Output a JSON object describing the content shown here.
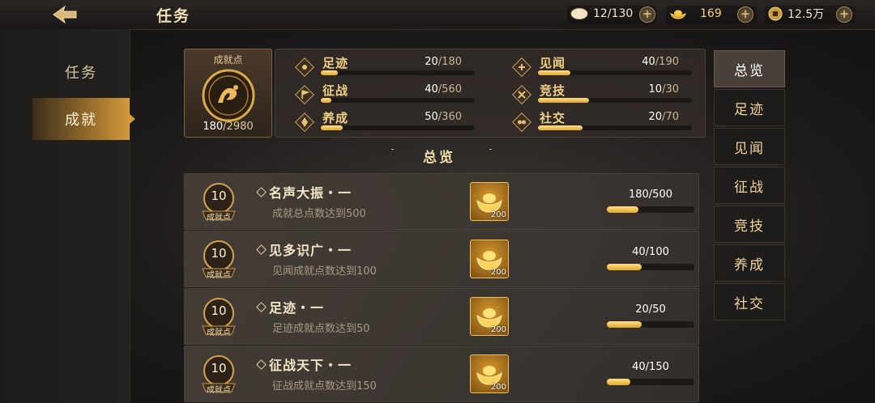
{
  "header": {
    "title": "任务"
  },
  "resources": [
    {
      "icon": "egg-icon",
      "value": "12/130"
    },
    {
      "icon": "gold-ingot-icon",
      "value": "169"
    },
    {
      "icon": "coin-icon",
      "value": "12.5万"
    }
  ],
  "left_tabs": [
    {
      "label": "任务",
      "active": false
    },
    {
      "label": "成就",
      "active": true
    }
  ],
  "summary": {
    "label": "成就点",
    "current": "180",
    "total": "/2980",
    "stats": [
      {
        "name": "足迹",
        "current": "20",
        "total": "/180",
        "ratio": 0.11
      },
      {
        "name": "见闻",
        "current": "40",
        "total": "/190",
        "ratio": 0.21
      },
      {
        "name": "征战",
        "current": "40",
        "total": "/560",
        "ratio": 0.07
      },
      {
        "name": "竞技",
        "current": "10",
        "total": "/30",
        "ratio": 0.33
      },
      {
        "name": "养成",
        "current": "50",
        "total": "/360",
        "ratio": 0.14
      },
      {
        "name": "社交",
        "current": "20",
        "total": "/70",
        "ratio": 0.29
      }
    ]
  },
  "section_title": "总览",
  "achievements": [
    {
      "points": "10",
      "points_label": "成就点",
      "title": "名声大振・一",
      "desc": "成就总点数达到500",
      "reward_qty": "200",
      "progress_text": "180/500",
      "ratio": 0.36
    },
    {
      "points": "10",
      "points_label": "成就点",
      "title": "见多识广・一",
      "desc": "见闻成就点数达到100",
      "reward_qty": "200",
      "progress_text": "40/100",
      "ratio": 0.4
    },
    {
      "points": "10",
      "points_label": "成就点",
      "title": "足迹・一",
      "desc": "足迹成就点数达到50",
      "reward_qty": "200",
      "progress_text": "20/50",
      "ratio": 0.4
    },
    {
      "points": "10",
      "points_label": "成就点",
      "title": "征战天下・一",
      "desc": "征战成就点数达到150",
      "reward_qty": "200",
      "progress_text": "40/150",
      "ratio": 0.27
    }
  ],
  "filters": [
    {
      "label": "总览",
      "active": true
    },
    {
      "label": "足迹",
      "active": false
    },
    {
      "label": "见闻",
      "active": false
    },
    {
      "label": "征战",
      "active": false
    },
    {
      "label": "竞技",
      "active": false
    },
    {
      "label": "养成",
      "active": false
    },
    {
      "label": "社交",
      "active": false
    }
  ],
  "colors": {
    "accent_gold": "#e2a62b",
    "panel": "#322c28"
  }
}
